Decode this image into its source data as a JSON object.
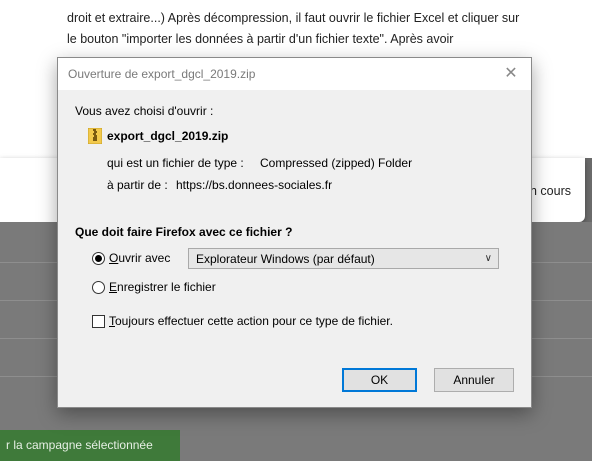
{
  "background": {
    "line1": "droit et extraire...) Après décompression, il faut ouvrir le fichier Excel et cliquer sur",
    "line2": "le bouton \"importer les données à partir d'un fichier texte\". Après avoir",
    "line3": "(fragment partially hidden)",
    "popup_right_text": "n cours",
    "green_button": "r la campagne sélectionnée"
  },
  "dialog": {
    "title": "Ouverture de export_dgcl_2019.zip",
    "close_glyph": "✕",
    "intro": "Vous avez choisi d'ouvrir :",
    "filename": "export_dgcl_2019.zip",
    "type_label": "qui est un fichier de type :",
    "type_value": "Compressed (zipped) Folder",
    "from_label": "à partir de :",
    "from_value": "https://bs.donnees-sociales.fr",
    "question": "Que doit faire Firefox avec ce fichier ?",
    "open_with_letter": "O",
    "open_with_rest": "uvrir avec",
    "open_with_app": "Explorateur Windows (par défaut)",
    "save_letter": "E",
    "save_rest": "nregistrer le fichier",
    "always_letter": "T",
    "always_rest": "oujours effectuer cette action pour ce type de fichier.",
    "ok_label": "OK",
    "cancel_label": "Annuler"
  }
}
